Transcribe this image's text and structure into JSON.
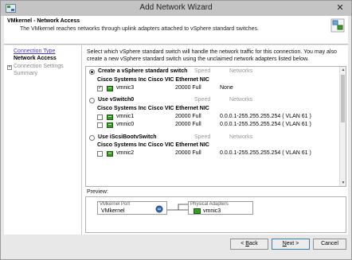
{
  "window": {
    "title": "Add Network Wizard",
    "close_label": "✕"
  },
  "header": {
    "title": "VMkernel - Network Access",
    "subtitle": "The VMkernel reaches networks through uplink adapters attached to vSphere standard switches."
  },
  "nav": {
    "items": [
      {
        "label": "Connection Type",
        "state": "link"
      },
      {
        "label": "Network Access",
        "state": "current"
      },
      {
        "label": "Connection Settings",
        "state": "future"
      },
      {
        "label": "Summary",
        "state": "future"
      }
    ],
    "expander": "+"
  },
  "content": {
    "instructions": "Select which vSphere standard switch will handle the network traffic for this connection. You may also create a new vSphere standard switch using the unclaimed network adapters listed below."
  },
  "columns": {
    "speed": "Speed",
    "networks": "Networks"
  },
  "options": [
    {
      "label": "Create a vSphere standard switch",
      "selected": true,
      "nic_group": "Cisco Systems Inc Cisco VIC Ethernet NIC",
      "adapters": [
        {
          "checked": true,
          "name": "vmnic3",
          "speed": "20000 Full",
          "networks": "None"
        }
      ]
    },
    {
      "label": "Use vSwitch0",
      "selected": false,
      "nic_group": "Cisco Systems Inc Cisco VIC Ethernet NIC",
      "adapters": [
        {
          "checked": false,
          "name": "vmnic1",
          "speed": "20000 Full",
          "networks": "0.0.0.1-255.255.255.254 ( VLAN 61 )"
        },
        {
          "checked": false,
          "name": "vmnic0",
          "speed": "20000 Full",
          "networks": "0.0.0.1-255.255.255.254 ( VLAN 61 )"
        }
      ]
    },
    {
      "label": "Use iScsiBootvSwitch",
      "selected": false,
      "nic_group": "Cisco Systems Inc Cisco VIC Ethernet NIC",
      "adapters": [
        {
          "checked": false,
          "name": "vmnic2",
          "speed": "20000 Full",
          "networks": "0.0.0.1-255.255.255.254 ( VLAN 61 )"
        }
      ]
    }
  ],
  "preview": {
    "label": "Preview:",
    "port_group_header": "VMkernel Port",
    "port_group_name": "VMkernel",
    "physical_header": "Physical Adapters",
    "physical_name": "vmnic3"
  },
  "buttons": {
    "back": {
      "prefix": "< ",
      "mnemonic": "B",
      "rest": "ack"
    },
    "next": {
      "mnemonic": "N",
      "rest": "ext",
      "suffix": " >"
    },
    "cancel": "Cancel"
  },
  "colors": {
    "link": "#4a3dbd",
    "nic_green": "#3a9a2a",
    "primary_border": "#3c7fb1"
  },
  "icons": {
    "title": "wizard-icon",
    "header": "vmware-logo-icon",
    "nic": "network-adapter-icon",
    "vmk": "vmkernel-port-icon"
  }
}
